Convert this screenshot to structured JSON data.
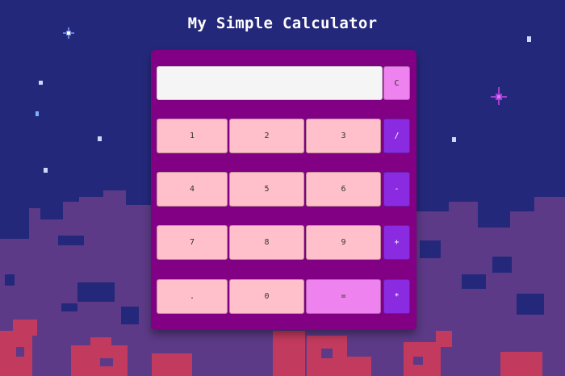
{
  "page": {
    "title": "My Simple Calculator"
  },
  "display": {
    "value": ""
  },
  "buttons": {
    "clear": "C",
    "rows": [
      [
        "1",
        "2",
        "3",
        "/"
      ],
      [
        "4",
        "5",
        "6",
        "-"
      ],
      [
        "7",
        "8",
        "9",
        "+"
      ],
      [
        ".",
        "0",
        "=",
        "*"
      ]
    ]
  },
  "colors": {
    "background": "#24287a",
    "calculator_body": "#820083",
    "number_button": "#ffc0cb",
    "operator_button": "#8a2be2",
    "clear_and_equals_button": "#ee82ee",
    "display": "#f5f5f5"
  }
}
